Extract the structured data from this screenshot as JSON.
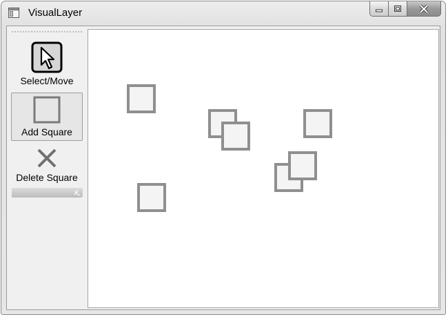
{
  "window": {
    "title": "VisualLayer",
    "caption_buttons": [
      "minimize",
      "maximize",
      "close"
    ]
  },
  "toolbar": {
    "tools": [
      {
        "label": "Select/Move",
        "icon": "arrow-cursor-icon",
        "selected": false
      },
      {
        "label": "Add Square",
        "icon": "square-outline-icon",
        "selected": true
      },
      {
        "label": "Delete Square",
        "icon": "x-icon",
        "selected": false
      }
    ]
  },
  "canvas": {
    "square_count": 7
  },
  "colors": {
    "square_stroke": "#8f8f8f",
    "square_fill": "#f4f4f4",
    "canvas_background": "#ffffff"
  }
}
